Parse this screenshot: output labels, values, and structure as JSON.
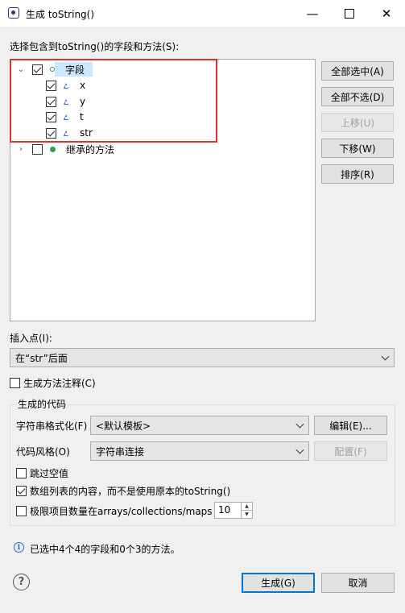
{
  "window": {
    "title": "生成 toString()",
    "min": "—",
    "close": "✕"
  },
  "tree_label": "选择包含到toString()的字段和方法(S):",
  "tree": {
    "fields_node": "字段",
    "fields": [
      "x",
      "y",
      "t",
      "str"
    ],
    "methods_node": "继承的方法"
  },
  "side_buttons": {
    "select_all": "全部选中(A)",
    "deselect_all": "全部不选(D)",
    "up": "上移(U)",
    "down": "下移(W)",
    "sort": "排序(R)"
  },
  "insert_label": "插入点(I):",
  "insert_value": "在“str”后面",
  "gen_comments": "生成方法注释(C)",
  "group": {
    "title": "生成的代码",
    "format_label": "字符串格式化(F)",
    "format_value": "<默认模板>",
    "edit_button": "编辑(E)...",
    "style_label": "代码风格(O)",
    "style_value": "字符串连接",
    "config_button": "配置(F)",
    "skip_null": "跳过空值",
    "array_contents": "数组列表的内容，而不是使用原本的toString()",
    "limit_items": "极限项目数量在arrays/collections/maps",
    "limit_value": "10"
  },
  "status": "已选中4个4的字段和0个3的方法。",
  "footer": {
    "generate": "生成(G)",
    "cancel": "取消"
  }
}
